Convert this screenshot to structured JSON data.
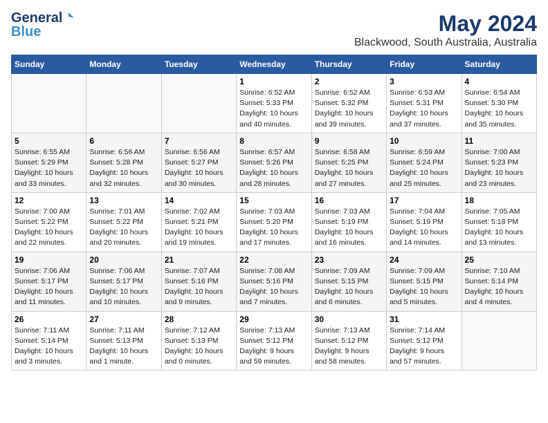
{
  "header": {
    "logo_general": "General",
    "logo_blue": "Blue",
    "title": "May 2024",
    "subtitle": "Blackwood, South Australia, Australia"
  },
  "columns": [
    "Sunday",
    "Monday",
    "Tuesday",
    "Wednesday",
    "Thursday",
    "Friday",
    "Saturday"
  ],
  "weeks": [
    {
      "days": [
        {
          "num": "",
          "info": ""
        },
        {
          "num": "",
          "info": ""
        },
        {
          "num": "",
          "info": ""
        },
        {
          "num": "1",
          "info": "Sunrise: 6:52 AM\nSunset: 5:33 PM\nDaylight: 10 hours\nand 40 minutes."
        },
        {
          "num": "2",
          "info": "Sunrise: 6:52 AM\nSunset: 5:32 PM\nDaylight: 10 hours\nand 39 minutes."
        },
        {
          "num": "3",
          "info": "Sunrise: 6:53 AM\nSunset: 5:31 PM\nDaylight: 10 hours\nand 37 minutes."
        },
        {
          "num": "4",
          "info": "Sunrise: 6:54 AM\nSunset: 5:30 PM\nDaylight: 10 hours\nand 35 minutes."
        }
      ]
    },
    {
      "days": [
        {
          "num": "5",
          "info": "Sunrise: 6:55 AM\nSunset: 5:29 PM\nDaylight: 10 hours\nand 33 minutes."
        },
        {
          "num": "6",
          "info": "Sunrise: 6:56 AM\nSunset: 5:28 PM\nDaylight: 10 hours\nand 32 minutes."
        },
        {
          "num": "7",
          "info": "Sunrise: 6:56 AM\nSunset: 5:27 PM\nDaylight: 10 hours\nand 30 minutes."
        },
        {
          "num": "8",
          "info": "Sunrise: 6:57 AM\nSunset: 5:26 PM\nDaylight: 10 hours\nand 28 minutes."
        },
        {
          "num": "9",
          "info": "Sunrise: 6:58 AM\nSunset: 5:25 PM\nDaylight: 10 hours\nand 27 minutes."
        },
        {
          "num": "10",
          "info": "Sunrise: 6:59 AM\nSunset: 5:24 PM\nDaylight: 10 hours\nand 25 minutes."
        },
        {
          "num": "11",
          "info": "Sunrise: 7:00 AM\nSunset: 5:23 PM\nDaylight: 10 hours\nand 23 minutes."
        }
      ]
    },
    {
      "days": [
        {
          "num": "12",
          "info": "Sunrise: 7:00 AM\nSunset: 5:22 PM\nDaylight: 10 hours\nand 22 minutes."
        },
        {
          "num": "13",
          "info": "Sunrise: 7:01 AM\nSunset: 5:22 PM\nDaylight: 10 hours\nand 20 minutes."
        },
        {
          "num": "14",
          "info": "Sunrise: 7:02 AM\nSunset: 5:21 PM\nDaylight: 10 hours\nand 19 minutes."
        },
        {
          "num": "15",
          "info": "Sunrise: 7:03 AM\nSunset: 5:20 PM\nDaylight: 10 hours\nand 17 minutes."
        },
        {
          "num": "16",
          "info": "Sunrise: 7:03 AM\nSunset: 5:19 PM\nDaylight: 10 hours\nand 16 minutes."
        },
        {
          "num": "17",
          "info": "Sunrise: 7:04 AM\nSunset: 5:19 PM\nDaylight: 10 hours\nand 14 minutes."
        },
        {
          "num": "18",
          "info": "Sunrise: 7:05 AM\nSunset: 5:18 PM\nDaylight: 10 hours\nand 13 minutes."
        }
      ]
    },
    {
      "days": [
        {
          "num": "19",
          "info": "Sunrise: 7:06 AM\nSunset: 5:17 PM\nDaylight: 10 hours\nand 11 minutes."
        },
        {
          "num": "20",
          "info": "Sunrise: 7:06 AM\nSunset: 5:17 PM\nDaylight: 10 hours\nand 10 minutes."
        },
        {
          "num": "21",
          "info": "Sunrise: 7:07 AM\nSunset: 5:16 PM\nDaylight: 10 hours\nand 9 minutes."
        },
        {
          "num": "22",
          "info": "Sunrise: 7:08 AM\nSunset: 5:16 PM\nDaylight: 10 hours\nand 7 minutes."
        },
        {
          "num": "23",
          "info": "Sunrise: 7:09 AM\nSunset: 5:15 PM\nDaylight: 10 hours\nand 6 minutes."
        },
        {
          "num": "24",
          "info": "Sunrise: 7:09 AM\nSunset: 5:15 PM\nDaylight: 10 hours\nand 5 minutes."
        },
        {
          "num": "25",
          "info": "Sunrise: 7:10 AM\nSunset: 5:14 PM\nDaylight: 10 hours\nand 4 minutes."
        }
      ]
    },
    {
      "days": [
        {
          "num": "26",
          "info": "Sunrise: 7:11 AM\nSunset: 5:14 PM\nDaylight: 10 hours\nand 3 minutes."
        },
        {
          "num": "27",
          "info": "Sunrise: 7:11 AM\nSunset: 5:13 PM\nDaylight: 10 hours\nand 1 minute."
        },
        {
          "num": "28",
          "info": "Sunrise: 7:12 AM\nSunset: 5:13 PM\nDaylight: 10 hours\nand 0 minutes."
        },
        {
          "num": "29",
          "info": "Sunrise: 7:13 AM\nSunset: 5:12 PM\nDaylight: 9 hours\nand 59 minutes."
        },
        {
          "num": "30",
          "info": "Sunrise: 7:13 AM\nSunset: 5:12 PM\nDaylight: 9 hours\nand 58 minutes."
        },
        {
          "num": "31",
          "info": "Sunrise: 7:14 AM\nSunset: 5:12 PM\nDaylight: 9 hours\nand 57 minutes."
        },
        {
          "num": "",
          "info": ""
        }
      ]
    }
  ]
}
